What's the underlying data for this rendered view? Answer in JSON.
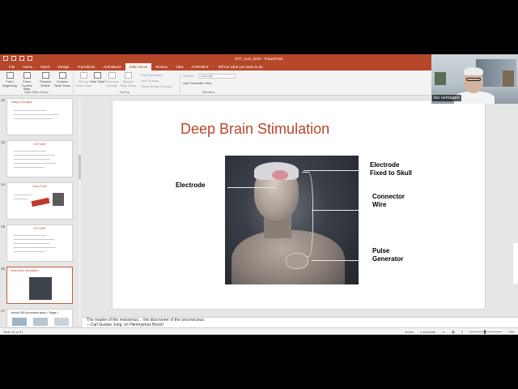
{
  "window": {
    "title": "ETF_ALD_2019 - PowerPoint"
  },
  "ribbon_tabs": [
    "File",
    "Home",
    "Insert",
    "Design",
    "Transitions",
    "Animations",
    "Slide Show",
    "Review",
    "View",
    "ACROBAT"
  ],
  "active_tab": "Slide Show",
  "tell_me": "Tell me what you want to do",
  "ribbon": {
    "from_beginning": "From Beginning",
    "from_current": "From Current Slide",
    "present_online": "Present Online",
    "custom_show": "Custom Slide Show",
    "start_group": "Start Slide Show",
    "setup_slideshow": "Set Up Slide Show",
    "hide_slide": "Hide Slide",
    "rehearse": "Rehearse Timings",
    "record": "Record Slide Show",
    "play_narrations": "Play Narrations",
    "use_timings": "Use Timings",
    "show_media": "Show Media Controls",
    "setup_group": "Set Up",
    "monitor_label": "Monitor:",
    "monitor_value": "Automatic",
    "presenter_view": "Use Presenter View",
    "monitors_group": "Monitors"
  },
  "thumbnails": [
    {
      "num": "12",
      "title": "Timing of Surgery"
    },
    {
      "num": "13",
      "title": "OUTLINE"
    },
    {
      "num": "14",
      "title": "Hurry Fred!"
    },
    {
      "num": "15",
      "title": "OUTLINE"
    },
    {
      "num": "16",
      "title": "Deep Brain Stimulation"
    },
    {
      "num": "17",
      "title": "Ventral DBS procedure steps > Stage 1"
    }
  ],
  "slide": {
    "title": "Deep Brain Stimulation",
    "labels": {
      "electrode": "Electrode",
      "fixed_line1": "Electrode",
      "fixed_line2": "Fixed to Skull",
      "connector_line1": "Connector",
      "connector_line2": "Wire",
      "pulse_line1": "Pulse",
      "pulse_line2": "Generator"
    }
  },
  "notes": {
    "line1": "The master of the monstrous… the discoverer of the unconscious.",
    "line2": "-- Carl Gustav Jung, on Hieronymus Bosch"
  },
  "status": {
    "slide_info": "Slide 16 of 37",
    "notes": "Notes",
    "comments": "Comments",
    "zoom": "72%"
  },
  "webcam": {
    "name": "leo verhagen"
  },
  "colors": {
    "accent": "#b7472a",
    "title_red": "#b7472a"
  }
}
